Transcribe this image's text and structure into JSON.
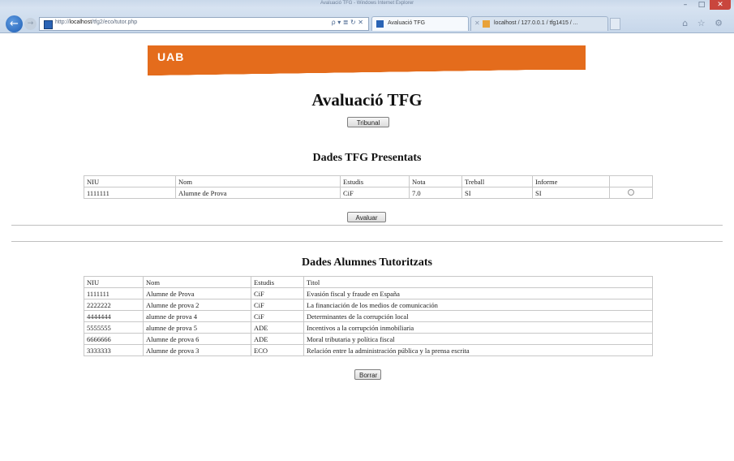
{
  "browser": {
    "window_title": "Avaluació TFG - Windows Internet Explorer",
    "url_prefix": "http://",
    "url_host": "localhost",
    "url_path": "/tfg2/eco/tutor.php",
    "address_icons": "ρ ▾ ≣ ↻ ✕",
    "tabs": [
      {
        "label": "Avaluació TFG",
        "close": ""
      },
      {
        "label": "localhost / 127.0.0.1 / tfg1415 / ...",
        "close": "✕"
      }
    ],
    "window_buttons": [
      "–",
      "□",
      "✕"
    ],
    "tool_icons": "⌂ ☆ ⚙"
  },
  "page": {
    "logo": "UAB",
    "title": "Avaluació TFG",
    "tribunal_button": "Tribunal",
    "section1_title": "Dades TFG Presentats",
    "table1": {
      "headers": [
        "NIU",
        "Nom",
        "Estudis",
        "Nota",
        "Treball",
        "Informe",
        ""
      ],
      "rows": [
        [
          "1111111",
          "Alumne de Prova",
          "CiF",
          "7.0",
          "SI",
          "SI"
        ]
      ]
    },
    "avaluar_button": "Avaluar",
    "section2_title": "Dades Alumnes Tutoritzats",
    "table2": {
      "headers": [
        "NIU",
        "Nom",
        "Estudis",
        "Titol"
      ],
      "rows": [
        [
          "1111111",
          "Alumne de Prova",
          "CiF",
          "Evasión fiscal y fraude en España"
        ],
        [
          "2222222",
          "Alumne de prova 2",
          "CiF",
          "La financiación de los medios de comunicación"
        ],
        [
          "4444444",
          "alumne de prova 4",
          "CiF",
          "Determinantes de la corrupción local"
        ],
        [
          "5555555",
          "alumne de prova 5",
          "ADE",
          "Incentivos a la corrupción inmobiliaria"
        ],
        [
          "6666666",
          "Alumne de prova 6",
          "ADE",
          "Moral tributaria y política fiscal"
        ],
        [
          "3333333",
          "Alumne de prova 3",
          "ECO",
          "Relación entre la administración pública y la prensa escrita"
        ]
      ]
    },
    "borrar_button": "Borrar",
    "colors": {
      "banner": "#e46c1c"
    }
  }
}
